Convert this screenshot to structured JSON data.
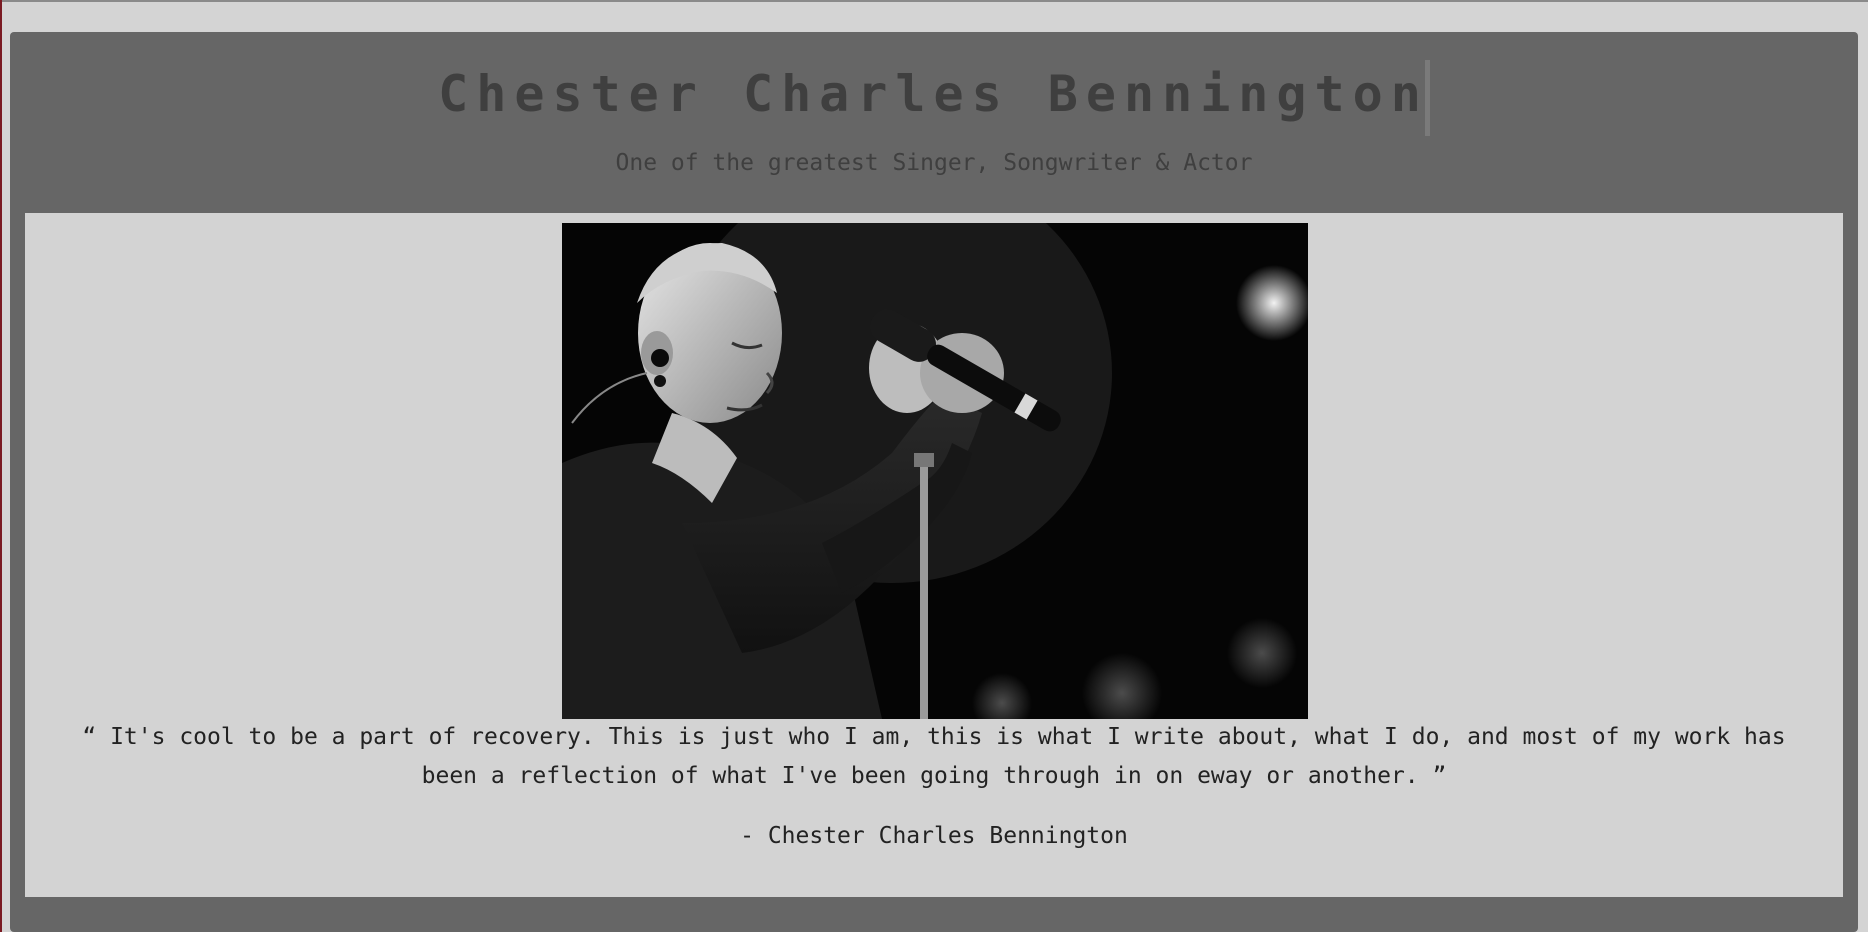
{
  "header": {
    "title": "Chester Charles Bennington",
    "subtitle": "One of the greatest Singer, Songwriter & Actor"
  },
  "tribute": {
    "image_alt": "Black and white photo of Chester Bennington holding a microphone",
    "quote": "“ It's cool to be a part of recovery. This is just who I am, this is what I write about, what I do, and most of my work has been a reflection of what I've been going through in on eway or another. ”",
    "attribution": "- Chester Charles Bennington"
  },
  "colors": {
    "frame": "#666666",
    "card": "#d3d3d3",
    "title_text": "#3f3f3f",
    "body_text": "#222222"
  }
}
